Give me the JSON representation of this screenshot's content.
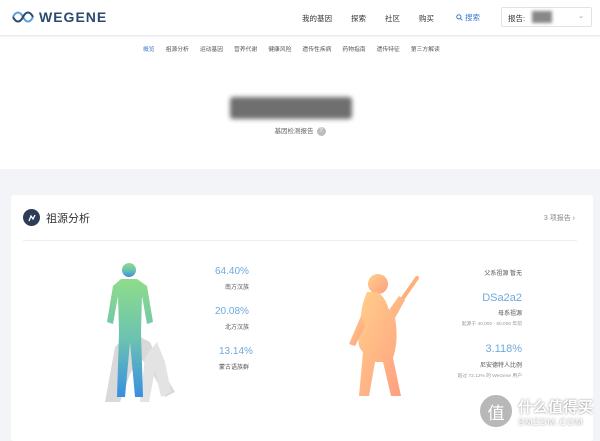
{
  "header": {
    "logo_text": "WEGENE",
    "nav": [
      "我的基因",
      "探索",
      "社区",
      "购买"
    ],
    "search_label": "搜索",
    "report_label": "报告: "
  },
  "subnav": {
    "items": [
      "概览",
      "祖源分析",
      "运动基因",
      "营养代谢",
      "健康风险",
      "遗传性疾病",
      "药物指南",
      "遗传特征",
      "第三方解读"
    ],
    "active": "概览"
  },
  "profile": {
    "report_label": "基因检测报告",
    "help_icon": "?"
  },
  "ancestry": {
    "title": "祖源分析",
    "link": "3 项报告",
    "groups": [
      {
        "percent": "64.40%",
        "label": "南方汉族"
      },
      {
        "percent": "20.08%",
        "label": "北方汉族"
      },
      {
        "percent": "13.14%",
        "label": "蒙古语族群"
      }
    ],
    "paternal": "父系祖源 暂无",
    "maternal_haplogroup": "DSa2a2",
    "maternal_label": "母系祖源",
    "maternal_origin": "起源于 40,000 - 60,000 年前",
    "neanderthal_percent": "3.118%",
    "neanderthal_label": "尼安德特人比例",
    "neanderthal_note": "超过 72.12% 的 WeGene 用户"
  },
  "watermark": {
    "icon": "值",
    "line1": "什么值得买",
    "line2": "SMZDM.COM"
  }
}
